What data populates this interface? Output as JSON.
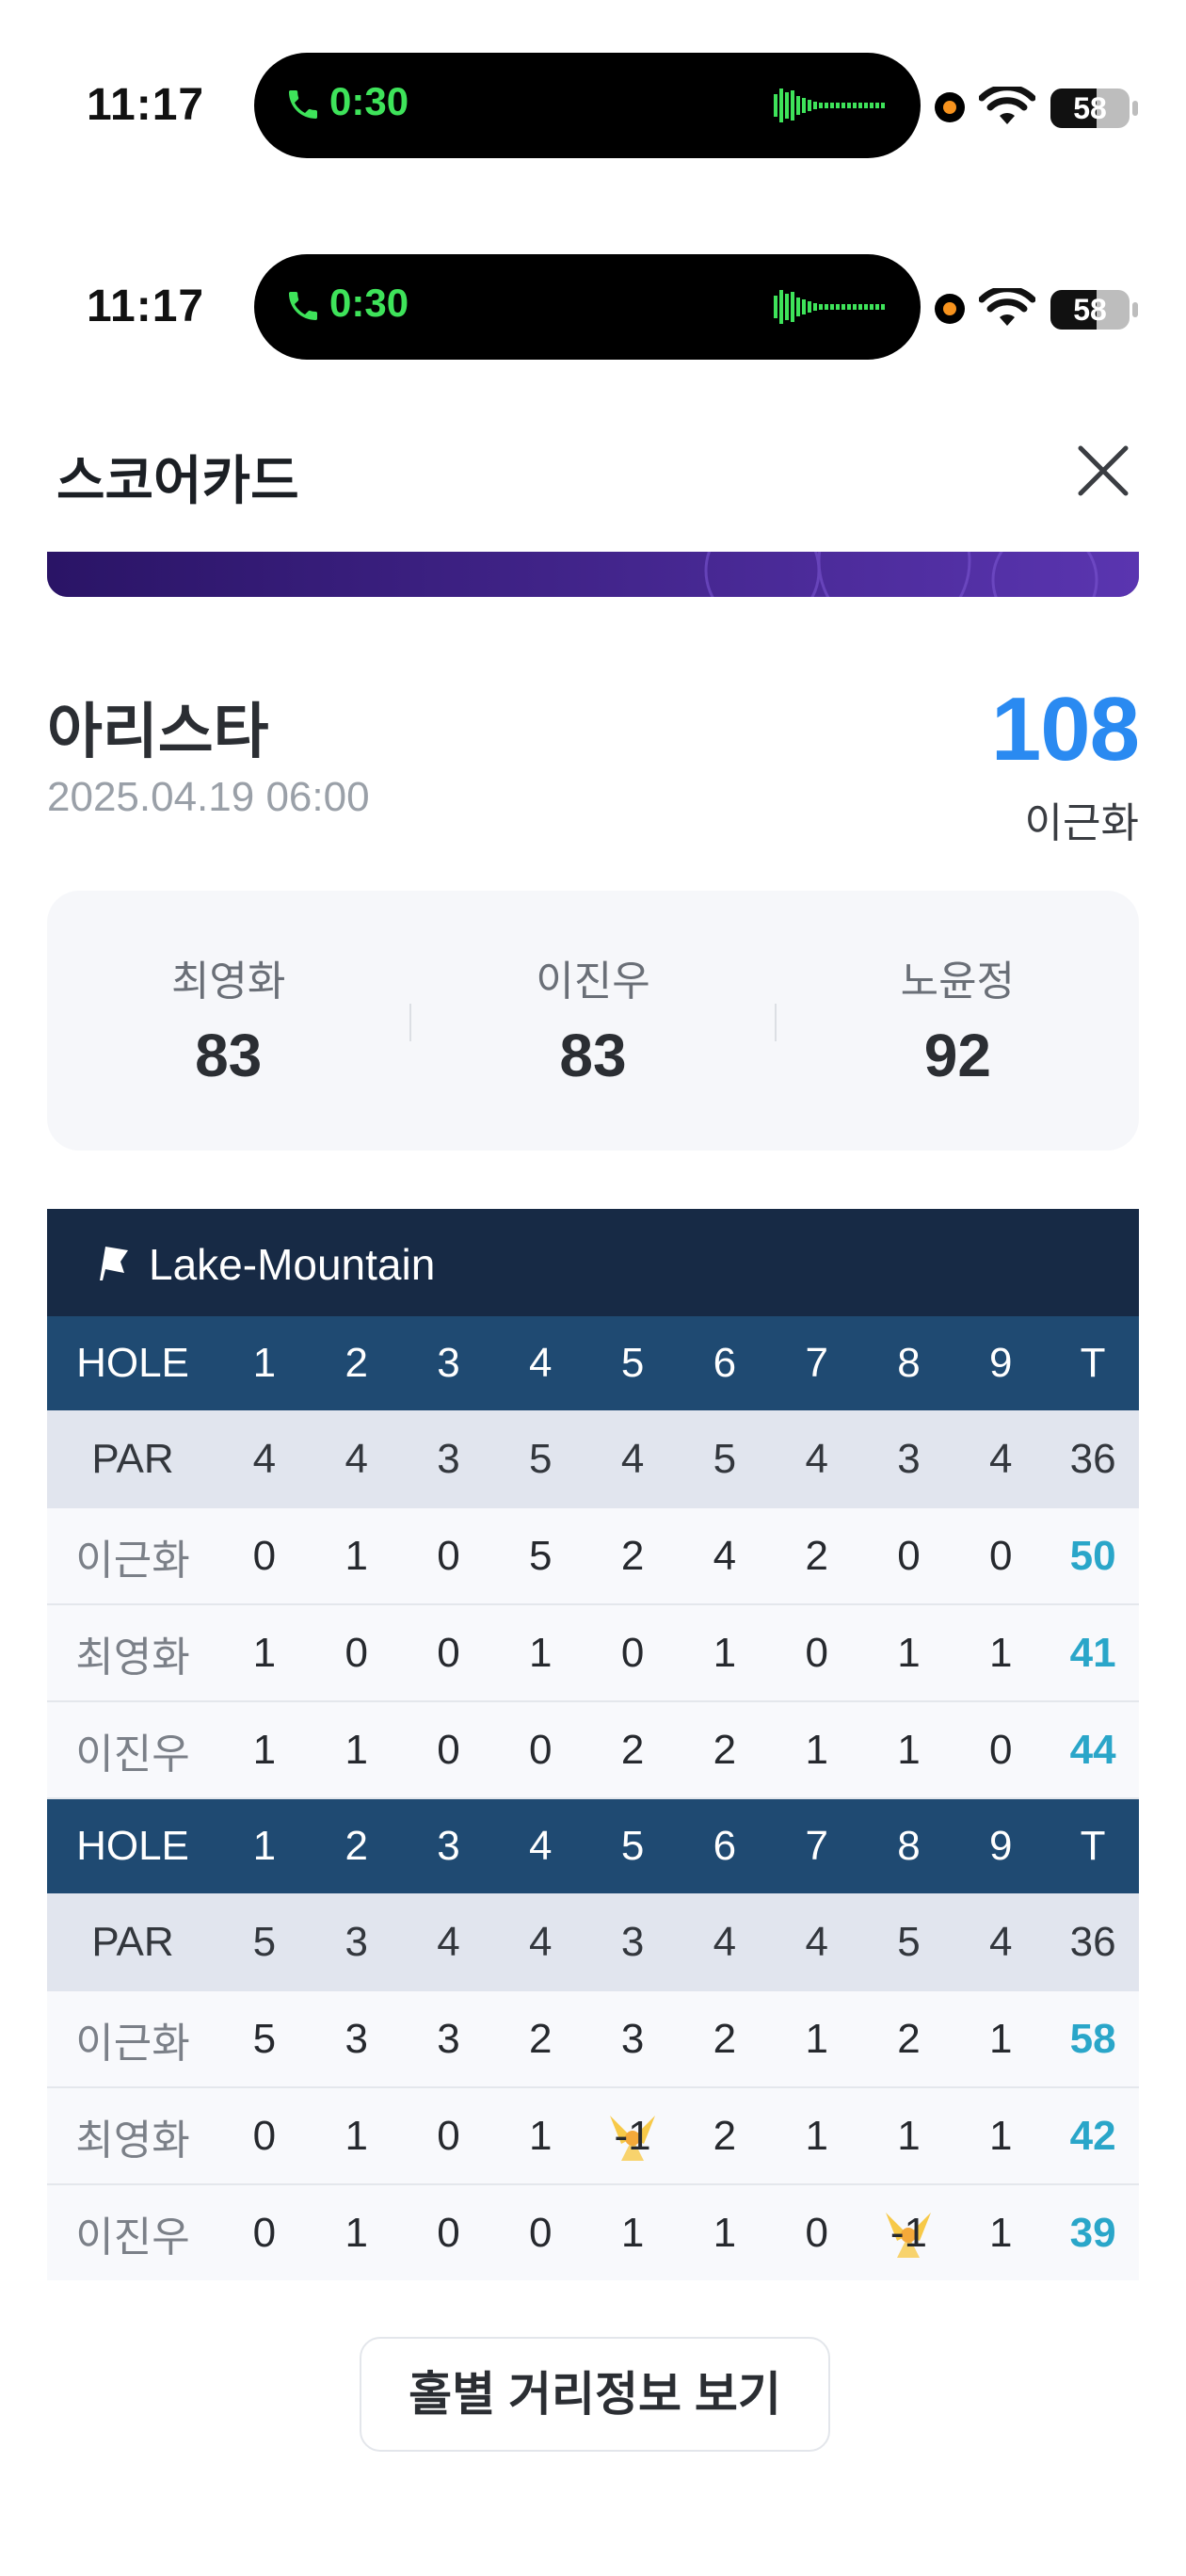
{
  "status_bars": [
    {
      "time": "11:17",
      "call_timer": "0:30",
      "battery": "58",
      "battery_level": 0.58
    },
    {
      "time": "11:17",
      "call_timer": "0:30",
      "battery": "58",
      "battery_level": 0.58
    }
  ],
  "header": {
    "title": "스코어카드"
  },
  "round": {
    "course": "아리스타",
    "datetime": "2025.04.19 06:00",
    "my_score": "108",
    "my_name": "이근화"
  },
  "others": [
    {
      "name": "최영화",
      "score": "83"
    },
    {
      "name": "이진우",
      "score": "83"
    },
    {
      "name": "노윤정",
      "score": "92"
    }
  ],
  "scorecard": {
    "course_name": "Lake-Mountain",
    "hole_label": "HOLE",
    "par_label": "PAR",
    "total_label": "T",
    "holes": [
      "1",
      "2",
      "3",
      "4",
      "5",
      "6",
      "7",
      "8",
      "9"
    ],
    "halves": [
      {
        "par": [
          "4",
          "4",
          "3",
          "5",
          "4",
          "5",
          "4",
          "3",
          "4"
        ],
        "par_total": "36",
        "players": [
          {
            "name": "이근화",
            "scores": [
              "0",
              "1",
              "0",
              "5",
              "2",
              "4",
              "2",
              "0",
              "0"
            ],
            "total": "50"
          },
          {
            "name": "최영화",
            "scores": [
              "1",
              "0",
              "0",
              "1",
              "0",
              "1",
              "0",
              "1",
              "1"
            ],
            "total": "41"
          },
          {
            "name": "이진우",
            "scores": [
              "1",
              "1",
              "0",
              "0",
              "2",
              "2",
              "1",
              "1",
              "0"
            ],
            "total": "44"
          }
        ]
      },
      {
        "par": [
          "5",
          "3",
          "4",
          "4",
          "3",
          "4",
          "4",
          "5",
          "4"
        ],
        "par_total": "36",
        "players": [
          {
            "name": "이근화",
            "scores": [
              "5",
              "3",
              "3",
              "2",
              "3",
              "2",
              "1",
              "2",
              "1"
            ],
            "total": "58"
          },
          {
            "name": "최영화",
            "scores": [
              "0",
              "1",
              "0",
              "1",
              "-1",
              "2",
              "1",
              "1",
              "1"
            ],
            "total": "42"
          },
          {
            "name": "이진우",
            "scores": [
              "0",
              "1",
              "0",
              "0",
              "1",
              "1",
              "0",
              "-1",
              "1"
            ],
            "total": "39"
          }
        ]
      }
    ]
  },
  "buttons": {
    "distance_info": "홀별 거리정보 보기"
  },
  "colors": {
    "accent_blue": "#2a8af1",
    "total_teal": "#2aa6c9",
    "header_navy": "#172a45",
    "hole_row": "#1f4a72",
    "birdie": "#f7c948"
  }
}
